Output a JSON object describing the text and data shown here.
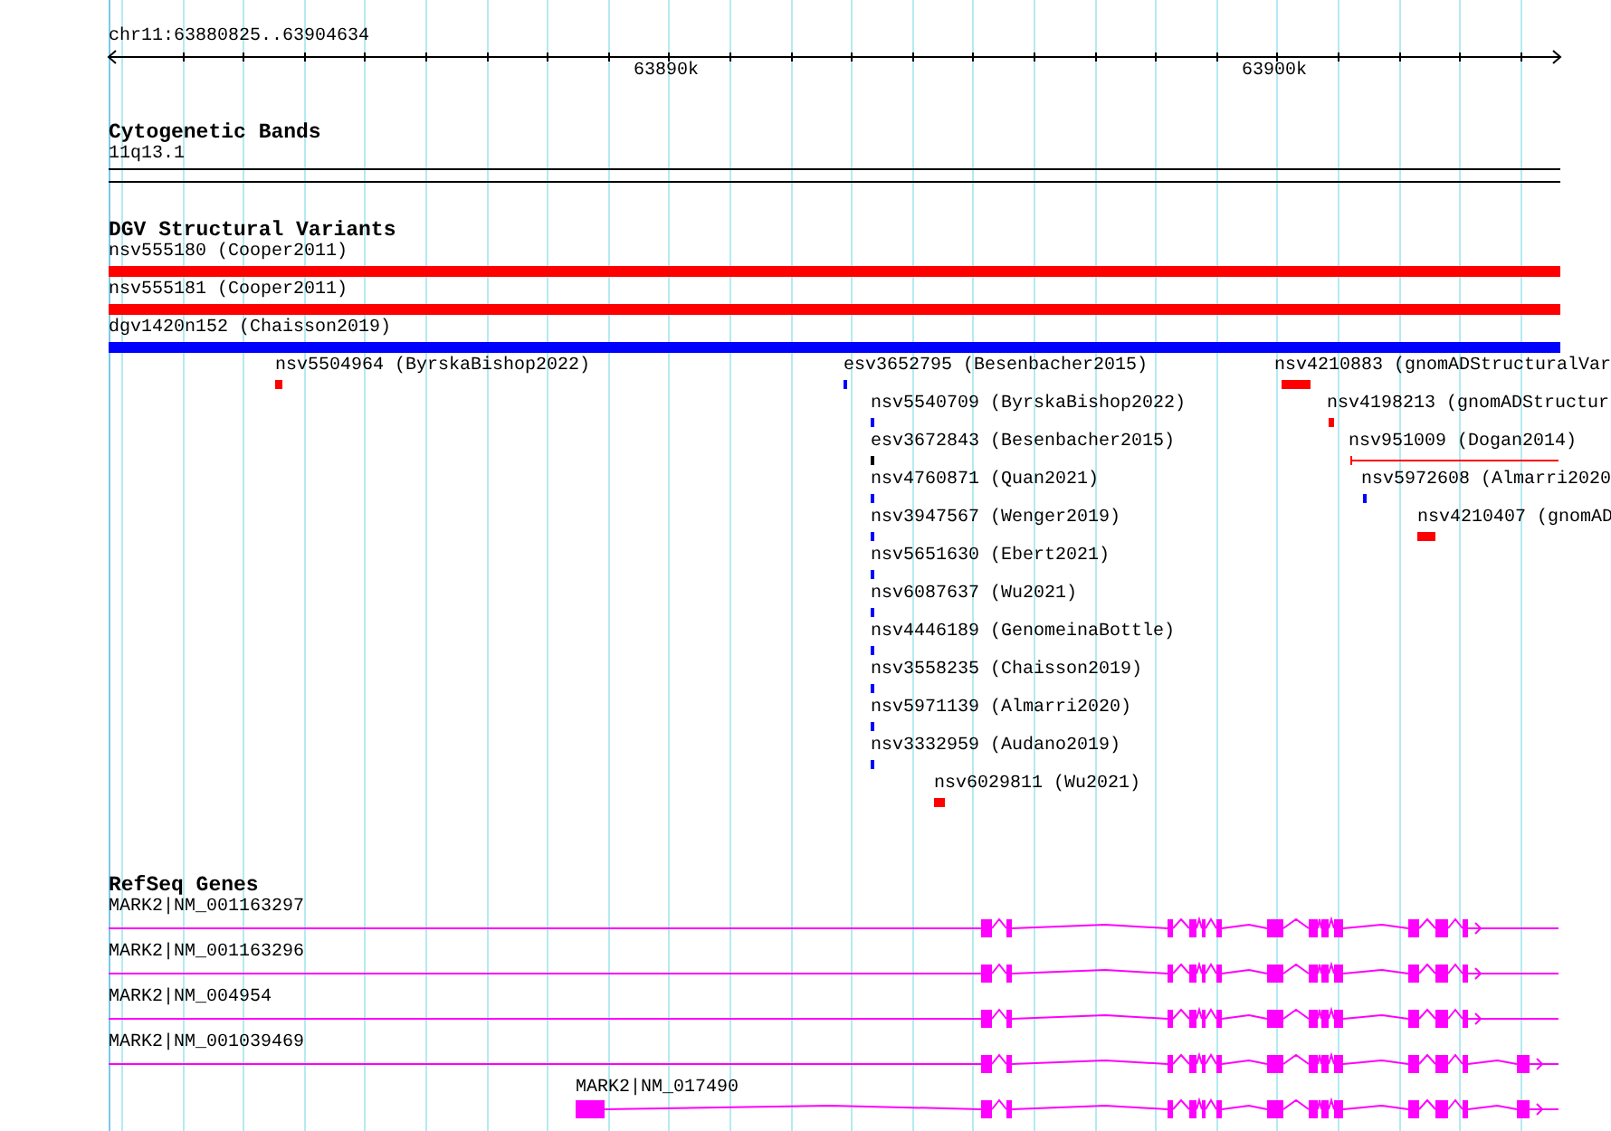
{
  "ruler": {
    "location": "chr11:63880825..63904634",
    "ticks": [
      "63890k",
      "63900k"
    ]
  },
  "tracks": [
    {
      "title": "Cytogenetic Bands",
      "kind": "bands",
      "features": [
        {
          "label": "11q13.1"
        }
      ]
    },
    {
      "title": "DGV Structural Variants",
      "kind": "variants",
      "features": [
        {
          "label": "nsv555180 (Cooper2011)",
          "kind": "box",
          "color": "#ff0000"
        },
        {
          "label": "nsv555181 (Cooper2011)",
          "kind": "box",
          "color": "#ff0000"
        },
        {
          "label": "dgv1420n152 (Chaisson2019)",
          "kind": "box",
          "color": "#0000ff"
        },
        {
          "label": "nsv5504964 (ByrskaBishop2022)",
          "kind": "box",
          "color": "#ff0000"
        },
        {
          "label": "esv3652795 (Besenbacher2015)",
          "kind": "box",
          "color": "#0000ff"
        },
        {
          "label": "nsv4210883 (gnomADStructuralVar",
          "kind": "box",
          "color": "#ff0000"
        },
        {
          "label": "nsv5540709 (ByrskaBishop2022)",
          "kind": "box",
          "color": "#0000ff"
        },
        {
          "label": "nsv4198213 (gnomADStructur",
          "kind": "box",
          "color": "#ff0000"
        },
        {
          "label": "esv3672843 (Besenbacher2015)",
          "kind": "box",
          "color": "#000000"
        },
        {
          "label": "nsv951009 (Dogan2014)",
          "kind": "line",
          "color": "#ff0000"
        },
        {
          "label": "nsv4760871 (Quan2021)",
          "kind": "box",
          "color": "#0000ff"
        },
        {
          "label": "nsv5972608 (Almarri2020",
          "kind": "box",
          "color": "#0000ff"
        },
        {
          "label": "nsv3947567 (Wenger2019)",
          "kind": "box",
          "color": "#0000ff"
        },
        {
          "label": "nsv4210407 (gnomAD",
          "kind": "box",
          "color": "#ff0000"
        },
        {
          "label": "nsv5651630 (Ebert2021)",
          "kind": "box",
          "color": "#0000ff"
        },
        {
          "label": "nsv6087637 (Wu2021)",
          "kind": "box",
          "color": "#0000ff"
        },
        {
          "label": "nsv4446189 (GenomeinaBottle)",
          "kind": "box",
          "color": "#0000ff"
        },
        {
          "label": "nsv3558235 (Chaisson2019)",
          "kind": "box",
          "color": "#0000ff"
        },
        {
          "label": "nsv5971139 (Almarri2020)",
          "kind": "box",
          "color": "#0000ff"
        },
        {
          "label": "nsv3332959 (Audano2019)",
          "kind": "box",
          "color": "#0000ff"
        },
        {
          "label": "nsv6029811 (Wu2021)",
          "kind": "box",
          "color": "#ff0000"
        }
      ]
    },
    {
      "title": "RefSeq Genes",
      "kind": "genes",
      "features": [
        {
          "label": "MARK2|NM_001163297"
        },
        {
          "label": "MARK2|NM_001163296"
        },
        {
          "label": "MARK2|NM_004954"
        },
        {
          "label": "MARK2|NM_001039469"
        },
        {
          "label": "MARK2|NM_017490"
        }
      ]
    }
  ]
}
